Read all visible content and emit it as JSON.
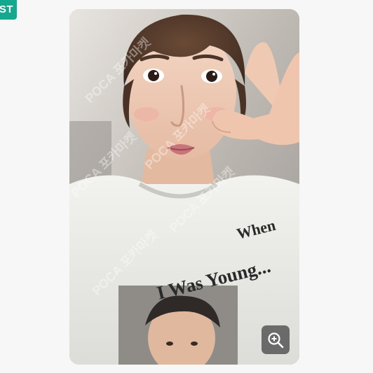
{
  "badge": {
    "label": "ST",
    "color": "#14a88f"
  },
  "photocard": {
    "shirt_text_line1": "When I Was Young...",
    "watermark_text": "POCA 포카마켓"
  },
  "zoom": {
    "icon": "zoom-in-icon"
  }
}
